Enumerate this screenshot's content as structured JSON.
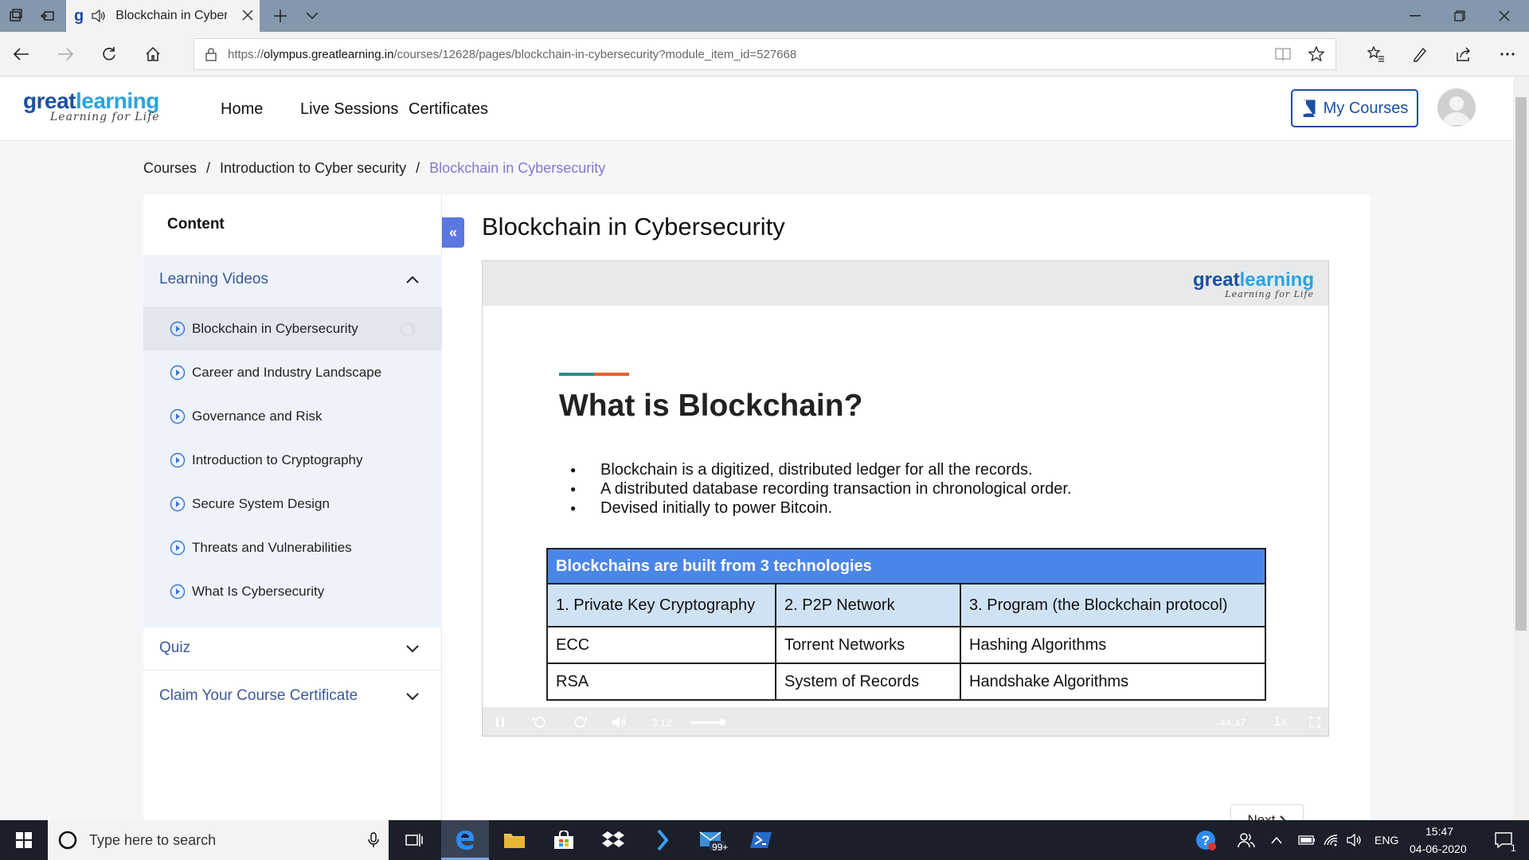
{
  "browser": {
    "tab_title": "Blockchain in Cyber",
    "url_prefix": "https://",
    "url_host": "olympus.greatlearning.in",
    "url_path": "/courses/12628/pages/blockchain-in-cybersecurity?module_item_id=527668"
  },
  "header": {
    "logo_main": "great",
    "logo_accent": "learning",
    "logo_tagline": "Learning for Life",
    "nav": [
      "Home",
      "Live Sessions",
      "Certificates"
    ],
    "my_courses": "My Courses"
  },
  "breadcrumb": {
    "items": [
      "Courses",
      "Introduction to Cyber security"
    ],
    "separator": "/",
    "current": "Blockchain in Cybersecurity"
  },
  "sidebar": {
    "heading": "Content",
    "section_videos": "Learning Videos",
    "lessons": [
      "Blockchain in Cybersecurity",
      "Career and Industry Landscape",
      "Governance and Risk",
      "Introduction to Cryptography",
      "Secure System Design",
      "Threats and Vulnerabilities",
      "What Is Cybersecurity"
    ],
    "section_quiz": "Quiz",
    "section_certificate": "Claim Your Course Certificate",
    "collapse": "«"
  },
  "main": {
    "title": "Blockchain in Cybersecurity",
    "next": "Next"
  },
  "slide": {
    "logo_main": "great",
    "logo_accent": "learning",
    "logo_tagline": "Learning for Life",
    "title": "What is Blockchain?",
    "bullets": [
      "Blockchain is a digitized, distributed ledger for all the records.",
      "A distributed database recording transaction in chronological order.",
      "Devised initially to power Bitcoin."
    ],
    "table_header": "Blockchains are built from 3 technologies",
    "table_rows": [
      [
        "1. Private Key Cryptography",
        "2. P2P Network",
        "3. Program (the Blockchain protocol)"
      ],
      [
        "ECC",
        "Torrent Networks",
        "Hashing Algorithms"
      ],
      [
        "RSA",
        "System of Records",
        "Handshake Algorithms"
      ]
    ],
    "accent_colors": [
      "#2a8a8a",
      "#e8622a"
    ]
  },
  "player": {
    "elapsed": "3:12",
    "remaining": "-44:47",
    "speed": "1x",
    "progress": 0.067
  },
  "taskbar": {
    "search_placeholder": "Type here to search",
    "mail_badge": "99+",
    "language": "ENG",
    "time": "15:47",
    "date": "04-06-2020",
    "notifications": "1"
  },
  "colors": {
    "brand": "#1b4fa3",
    "accent": "#2aa3e0",
    "active_breadcrumb": "#8a74d0",
    "table_header": "#4a86e8"
  }
}
